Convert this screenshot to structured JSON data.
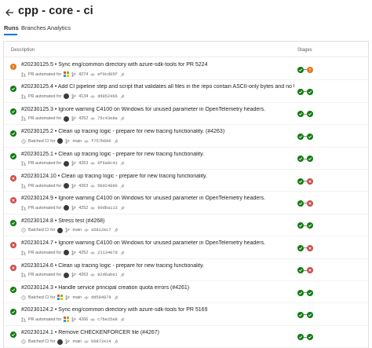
{
  "header": {
    "title": "cpp - core - ci"
  },
  "tabs": [
    {
      "label": "Runs",
      "active": true
    },
    {
      "label": "Branches",
      "active": false
    },
    {
      "label": "Analytics",
      "active": false
    }
  ],
  "table": {
    "col_description": "Description",
    "col_stages": "Stages"
  },
  "colors": {
    "success": "#107c10",
    "failed": "#cd4a45",
    "warning": "#e17a1e",
    "accent": "#0078d4"
  },
  "runs": [
    {
      "status": "warning",
      "title": "#20230125.5 • Sync eng/common directory with azure-sdk-tools for PR 5224",
      "trigger": "PR automated for",
      "avatar": "ms",
      "ref": "4274",
      "ref_type": "pr",
      "commit": "ef0cd05f",
      "stages": [
        "success",
        "warning"
      ]
    },
    {
      "status": "success",
      "title": "#20230125.4 • Add CI pipeline step and script that validates all files in the repo contain ASCII-only bytes and no UTF-8 ...",
      "trigger": "PR automated for",
      "avatar": "person",
      "ref": "4134",
      "ref_type": "pr",
      "commit": "dd852466",
      "stages": [
        "success",
        "success"
      ]
    },
    {
      "status": "success",
      "title": "#20230125.3 • Ignore warning C4100 on Windows for unused parameter in OpenTelemetry headers.",
      "trigger": "PR automated for",
      "avatar": "person",
      "ref": "4252",
      "ref_type": "pr",
      "commit": "75c43e8a",
      "stages": [
        "success",
        "success"
      ]
    },
    {
      "status": "success",
      "title": "#20230125.2 • Clean up tracing logic - prepare for new tracing functionality. (#4263)",
      "trigger": "Batched CI for",
      "avatar": "person",
      "ref": "main",
      "ref_type": "branch",
      "commit": "f757b0b0",
      "stages": [
        "success",
        "success"
      ]
    },
    {
      "status": "success",
      "title": "#20230125.1 • Clean up tracing logic - prepare for new tracing functionality.",
      "trigger": "PR automated for",
      "avatar": "person",
      "ref": "4263",
      "ref_type": "pr",
      "commit": "6f6a8c41",
      "stages": [
        "success",
        "success"
      ]
    },
    {
      "status": "failed",
      "title": "#20230124.10 • Clean up tracing logic - prepare for new tracing functionality.",
      "trigger": "PR automated for",
      "avatar": "person",
      "ref": "4263",
      "ref_type": "pr",
      "commit": "5b924890",
      "stages": [
        "success",
        "failed"
      ]
    },
    {
      "status": "failed",
      "title": "#20230124.9 • Ignore warning C4100 on Windows for unused parameter in OpenTelemetry headers.",
      "trigger": "PR automated for",
      "avatar": "person",
      "ref": "4252",
      "ref_type": "pr",
      "commit": "60dba113",
      "stages": [
        "success",
        "failed"
      ]
    },
    {
      "status": "success",
      "title": "#20230124.8 • Stress test (#4268)",
      "trigger": "Batched CI for",
      "avatar": "person",
      "ref": "main",
      "ref_type": "branch",
      "commit": "a5812ec7",
      "stages": [
        "success",
        "success"
      ]
    },
    {
      "status": "failed",
      "title": "#20230124.7 • Ignore warning C4100 on Windows for unused parameter in OpenTelemetry headers.",
      "trigger": "PR automated for",
      "avatar": "person",
      "ref": "4252",
      "ref_type": "pr",
      "commit": "2113407d",
      "stages": [
        "success",
        "failed"
      ]
    },
    {
      "status": "failed",
      "title": "#20230124.6 • Clean up tracing logic - prepare for new tracing functionality.",
      "trigger": "PR automated for",
      "avatar": "person",
      "ref": "4263",
      "ref_type": "pr",
      "commit": "92d6abe1",
      "stages": [
        "success",
        "failed"
      ]
    },
    {
      "status": "success",
      "title": "#20230124.3 • Handle service principal creation quota errors (#4261)",
      "trigger": "Batched CI for",
      "avatar": "ms",
      "ref": "main",
      "ref_type": "branch",
      "commit": "dd584879",
      "stages": [
        "success",
        "success"
      ]
    },
    {
      "status": "success",
      "title": "#20230124.2 • Sync eng/common directory with azure-sdk-tools for PR 5169",
      "trigger": "PR automated for",
      "avatar": "ms",
      "ref": "4266",
      "ref_type": "pr",
      "commit": "c7be25e8",
      "stages": [
        "success",
        "success"
      ]
    },
    {
      "status": "success",
      "title": "#20230124.1 • Remove CHECKENFORCER file (#4267)",
      "trigger": "Batched CI for",
      "avatar": "person",
      "ref": "main",
      "ref_type": "branch",
      "commit": "b0872e14",
      "stages": [
        "success",
        "success"
      ]
    }
  ]
}
